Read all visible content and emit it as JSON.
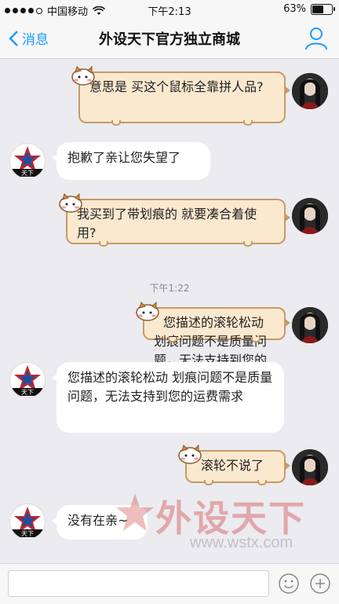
{
  "status": {
    "carrier": "中国移动",
    "time": "下午2:13",
    "battery": "63%",
    "battery_level": 0.63
  },
  "nav": {
    "back_label": "消息",
    "title": "外设天下官方独立商城"
  },
  "messages": [
    {
      "direction": "out",
      "text": "意思是 买这个鼠标全靠拼人品?"
    },
    {
      "direction": "in",
      "text": "抱歉了亲让您失望了"
    },
    {
      "direction": "out",
      "text": "我买到了带划痕的 就要凑合着使用?"
    },
    {
      "direction": "in",
      "text": "您描述的滚轮松动 划痕问题不是质量问题，无法支持到您的运费需求"
    },
    {
      "direction": "out",
      "text": "滚轮不说了"
    },
    {
      "direction": "in",
      "text": "没有在亲~"
    }
  ],
  "timestamp": "下午1:22",
  "avatar_shop_label": "天下",
  "watermark": {
    "text": "外设天下",
    "url": "www.wstx.com"
  },
  "icons": {
    "emoji": "smile-icon",
    "add": "plus-icon",
    "profile": "person-icon",
    "back": "chevron-left-icon"
  }
}
